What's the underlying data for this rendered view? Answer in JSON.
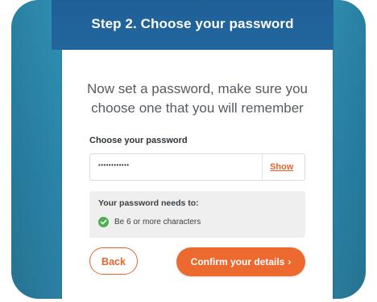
{
  "header": {
    "title": "Step 2. Choose your password"
  },
  "card": {
    "intro_line1": "Now set a password, make sure you",
    "intro_line2": "choose one that you will remember",
    "field_label": "Choose your password",
    "password_value": "••••••••••••",
    "show_label": "Show",
    "requirements": {
      "title": "Your password needs to:",
      "items": [
        {
          "text": "Be 6 or more characters",
          "met": true,
          "icon": "check-circle-icon"
        }
      ]
    },
    "back_label": "Back",
    "confirm_label": "Confirm your details",
    "confirm_chevron": "›"
  },
  "colors": {
    "accent": "#ec6a2f",
    "header_band": "#1f5f97",
    "frame_bg": "#2f8fb3",
    "success": "#4caf50"
  }
}
